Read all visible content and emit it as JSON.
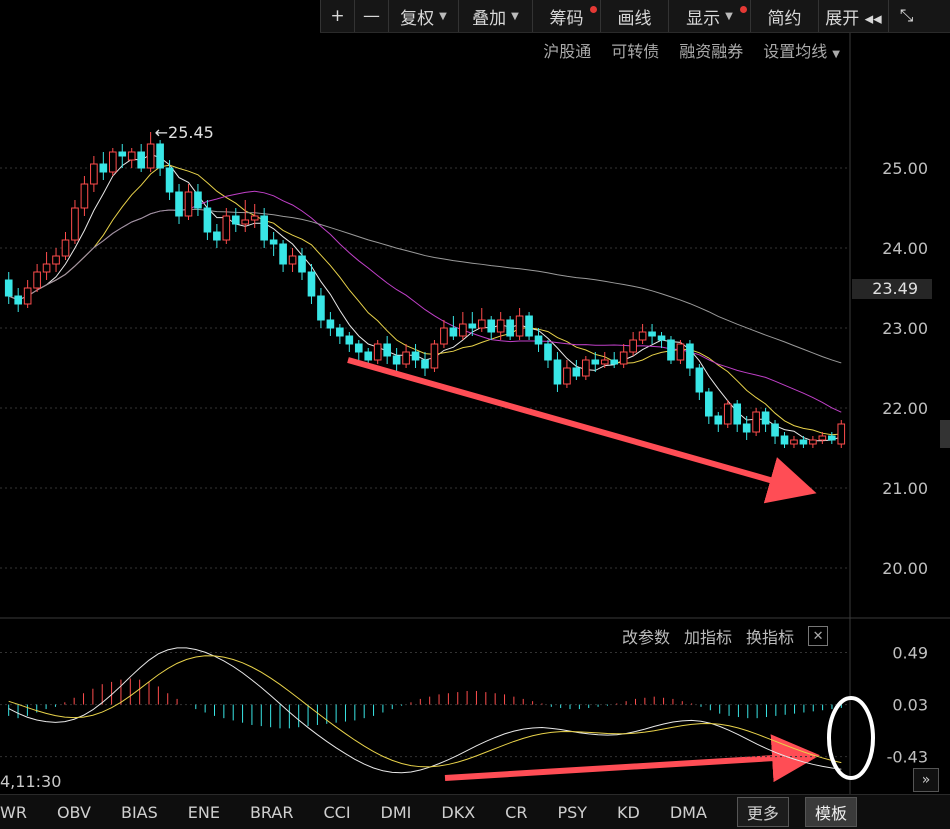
{
  "toolbar": {
    "items": [
      {
        "label": "+",
        "w": 34
      },
      {
        "label": "—",
        "w": 34
      },
      {
        "label": "复权",
        "w": 70,
        "arrow": true
      },
      {
        "label": "叠加",
        "w": 74,
        "arrow": true
      },
      {
        "label": "筹码",
        "w": 68,
        "dot": "#e53935"
      },
      {
        "label": "画线",
        "w": 68
      },
      {
        "label": "显示",
        "w": 82,
        "arrow": true,
        "dot": "#e53935"
      },
      {
        "label": "简约",
        "w": 68
      },
      {
        "label": "展开 ◂◂",
        "w": 70
      },
      {
        "label": "⤡",
        "w": 36
      }
    ]
  },
  "subbar": {
    "items": [
      "沪股通",
      "可转债",
      "融资融券",
      "设置均线"
    ]
  },
  "panel_controls": {
    "modify_params": "改参数",
    "add_indicator": "加指标",
    "change_indicator": "换指标",
    "close": "✕"
  },
  "time_label": "4,11:30",
  "price_tag": "23.49",
  "indicator_tabs": [
    "WR",
    "OBV",
    "BIAS",
    "ENE",
    "BRAR",
    "CCI",
    "DMI",
    "DKX",
    "CR",
    "PSY",
    "KD",
    "DMA"
  ],
  "more_btn": "更多",
  "template_btn": "模板",
  "chart_data": [
    {
      "type": "candlestick",
      "y_ticks": [
        25.0,
        24.0,
        23.0,
        22.0,
        21.0,
        20.0
      ],
      "y_tick_labels": [
        "25.00",
        "24.00",
        "23.00",
        "22.00",
        "21.00",
        "20.00"
      ],
      "ylim": [
        19.6,
        26.0
      ],
      "annotation": {
        "text": "←25.45",
        "value": 25.45
      },
      "last_price": 23.49,
      "candles": [
        [
          23.6,
          23.4,
          23.7,
          23.3
        ],
        [
          23.4,
          23.3,
          23.5,
          23.2
        ],
        [
          23.3,
          23.5,
          23.6,
          23.25
        ],
        [
          23.5,
          23.7,
          23.8,
          23.45
        ],
        [
          23.7,
          23.8,
          23.95,
          23.6
        ],
        [
          23.8,
          23.9,
          24.0,
          23.7
        ],
        [
          23.9,
          24.1,
          24.2,
          23.85
        ],
        [
          24.1,
          24.5,
          24.6,
          24.05
        ],
        [
          24.5,
          24.8,
          24.9,
          24.4
        ],
        [
          24.8,
          25.05,
          25.15,
          24.7
        ],
        [
          25.05,
          24.95,
          25.2,
          24.85
        ],
        [
          24.95,
          25.2,
          25.25,
          24.9
        ],
        [
          25.2,
          25.15,
          25.3,
          25.0
        ],
        [
          25.1,
          25.2,
          25.25,
          25.0
        ],
        [
          25.2,
          25.0,
          25.3,
          24.95
        ],
        [
          25.0,
          25.3,
          25.45,
          24.95
        ],
        [
          25.3,
          25.0,
          25.35,
          24.9
        ],
        [
          25.0,
          24.7,
          25.1,
          24.6
        ],
        [
          24.7,
          24.4,
          24.8,
          24.3
        ],
        [
          24.4,
          24.7,
          24.8,
          24.35
        ],
        [
          24.7,
          24.5,
          24.8,
          24.4
        ],
        [
          24.5,
          24.2,
          24.6,
          24.1
        ],
        [
          24.2,
          24.1,
          24.3,
          24.0
        ],
        [
          24.1,
          24.4,
          24.5,
          24.05
        ],
        [
          24.4,
          24.3,
          24.5,
          24.2
        ],
        [
          24.3,
          24.35,
          24.6,
          24.2
        ],
        [
          24.35,
          24.4,
          24.55,
          24.25
        ],
        [
          24.4,
          24.1,
          24.5,
          24.0
        ],
        [
          24.1,
          24.05,
          24.2,
          23.9
        ],
        [
          24.05,
          23.8,
          24.1,
          23.7
        ],
        [
          23.8,
          23.9,
          24.0,
          23.7
        ],
        [
          23.9,
          23.7,
          24.0,
          23.6
        ],
        [
          23.7,
          23.4,
          23.8,
          23.3
        ],
        [
          23.4,
          23.1,
          23.5,
          23.0
        ],
        [
          23.1,
          23.0,
          23.2,
          22.9
        ],
        [
          23.0,
          22.9,
          23.05,
          22.8
        ],
        [
          22.9,
          22.8,
          22.95,
          22.7
        ],
        [
          22.8,
          22.7,
          22.85,
          22.6
        ],
        [
          22.7,
          22.6,
          22.75,
          22.55
        ],
        [
          22.6,
          22.8,
          22.85,
          22.55
        ],
        [
          22.8,
          22.65,
          22.9,
          22.55
        ],
        [
          22.65,
          22.55,
          22.75,
          22.45
        ],
        [
          22.55,
          22.7,
          22.8,
          22.5
        ],
        [
          22.7,
          22.6,
          22.8,
          22.5
        ],
        [
          22.6,
          22.5,
          22.7,
          22.4
        ],
        [
          22.5,
          22.8,
          22.85,
          22.45
        ],
        [
          22.8,
          23.0,
          23.1,
          22.75
        ],
        [
          23.0,
          22.9,
          23.15,
          22.85
        ],
        [
          22.9,
          23.05,
          23.2,
          22.85
        ],
        [
          23.05,
          23.0,
          23.2,
          22.9
        ],
        [
          23.0,
          23.1,
          23.25,
          22.95
        ],
        [
          23.1,
          22.95,
          23.15,
          22.85
        ],
        [
          22.95,
          23.1,
          23.2,
          22.85
        ],
        [
          23.1,
          22.9,
          23.15,
          22.85
        ],
        [
          22.9,
          23.15,
          23.25,
          22.85
        ],
        [
          23.15,
          22.9,
          23.2,
          22.85
        ],
        [
          22.9,
          22.8,
          23.0,
          22.7
        ],
        [
          22.8,
          22.6,
          22.85,
          22.5
        ],
        [
          22.6,
          22.3,
          22.7,
          22.2
        ],
        [
          22.3,
          22.5,
          22.6,
          22.25
        ],
        [
          22.5,
          22.4,
          22.6,
          22.35
        ],
        [
          22.4,
          22.6,
          22.65,
          22.35
        ],
        [
          22.6,
          22.55,
          22.7,
          22.45
        ],
        [
          22.55,
          22.6,
          22.7,
          22.5
        ],
        [
          22.6,
          22.55,
          22.7,
          22.5
        ],
        [
          22.55,
          22.7,
          22.8,
          22.5
        ],
        [
          22.7,
          22.85,
          22.95,
          22.65
        ],
        [
          22.85,
          22.95,
          23.05,
          22.8
        ],
        [
          22.95,
          22.9,
          23.05,
          22.8
        ],
        [
          22.9,
          22.85,
          22.95,
          22.75
        ],
        [
          22.85,
          22.6,
          22.9,
          22.55
        ],
        [
          22.6,
          22.8,
          22.85,
          22.55
        ],
        [
          22.8,
          22.5,
          22.85,
          22.4
        ],
        [
          22.5,
          22.2,
          22.55,
          22.1
        ],
        [
          22.2,
          21.9,
          22.25,
          21.8
        ],
        [
          21.9,
          21.8,
          21.95,
          21.7
        ],
        [
          21.8,
          22.05,
          22.1,
          21.75
        ],
        [
          22.05,
          21.8,
          22.1,
          21.7
        ],
        [
          21.8,
          21.7,
          21.9,
          21.6
        ],
        [
          21.7,
          21.95,
          22.0,
          21.65
        ],
        [
          21.95,
          21.8,
          22.0,
          21.7
        ],
        [
          21.8,
          21.65,
          21.85,
          21.55
        ],
        [
          21.65,
          21.55,
          21.7,
          21.5
        ],
        [
          21.55,
          21.6,
          21.65,
          21.5
        ],
        [
          21.6,
          21.55,
          21.65,
          21.5
        ],
        [
          21.55,
          21.6,
          21.65,
          21.5
        ],
        [
          21.6,
          21.65,
          21.7,
          21.55
        ],
        [
          21.65,
          21.6,
          21.7,
          21.55
        ],
        [
          21.55,
          21.8,
          21.85,
          21.5
        ]
      ]
    },
    {
      "type": "macd",
      "y_ticks": [
        0.49,
        0.03,
        -0.43
      ],
      "y_tick_labels": [
        "0.49",
        "0.03",
        "-0.43"
      ],
      "ylim": [
        -0.53,
        0.6
      ],
      "zero": 0.03,
      "hist": [
        -0.1,
        -0.12,
        -0.1,
        -0.07,
        -0.04,
        -0.02,
        0.02,
        0.06,
        0.1,
        0.14,
        0.18,
        0.2,
        0.22,
        0.23,
        0.22,
        0.2,
        0.16,
        0.1,
        0.05,
        0.0,
        -0.04,
        -0.07,
        -0.1,
        -0.12,
        -0.14,
        -0.16,
        -0.18,
        -0.19,
        -0.2,
        -0.21,
        -0.21,
        -0.2,
        -0.19,
        -0.18,
        -0.17,
        -0.16,
        -0.15,
        -0.14,
        -0.12,
        -0.1,
        -0.07,
        -0.04,
        -0.01,
        0.02,
        0.05,
        0.07,
        0.09,
        0.1,
        0.11,
        0.12,
        0.12,
        0.11,
        0.1,
        0.09,
        0.07,
        0.05,
        0.03,
        0.01,
        -0.02,
        -0.03,
        -0.04,
        -0.04,
        -0.03,
        -0.02,
        -0.01,
        0.01,
        0.03,
        0.05,
        0.06,
        0.07,
        0.06,
        0.05,
        0.03,
        0.01,
        -0.02,
        -0.05,
        -0.08,
        -0.1,
        -0.11,
        -0.12,
        -0.12,
        -0.11,
        -0.1,
        -0.09,
        -0.08,
        -0.07,
        -0.06,
        -0.05,
        -0.04,
        -0.03
      ],
      "dif_start": 0.0,
      "dea_start": 0.05
    }
  ]
}
